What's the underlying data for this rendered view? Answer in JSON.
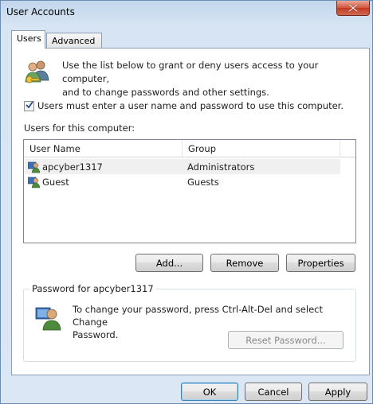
{
  "window": {
    "title": "User Accounts"
  },
  "tabs": [
    {
      "label": "Users",
      "selected": true
    },
    {
      "label": "Advanced",
      "selected": false
    }
  ],
  "users_tab": {
    "intro_line1": "Use the list below to grant or deny users access to your computer,",
    "intro_line2": "and to change passwords and other settings.",
    "require_login_label": "Users must enter a user name and password to use this computer.",
    "require_login_checked": true,
    "list_label": "Users for this computer:",
    "columns": [
      "User Name",
      "Group"
    ],
    "users": [
      {
        "name": "apcyber1317",
        "group": "Administrators",
        "selected": true
      },
      {
        "name": "Guest",
        "group": "Guests",
        "selected": false
      }
    ],
    "buttons": {
      "add": "Add...",
      "remove": "Remove",
      "properties": "Properties"
    },
    "password_group": {
      "legend": "Password for apcyber1317",
      "text_line1": "To change your password, press Ctrl-Alt-Del and select Change",
      "text_line2": "Password.",
      "reset_button": "Reset Password...",
      "reset_enabled": false
    }
  },
  "footer": {
    "ok": "OK",
    "cancel": "Cancel",
    "apply": "Apply"
  },
  "icons": {
    "close": "close-icon",
    "users": "users-key-icon",
    "user": "user-icon",
    "check": "checkmark-icon"
  },
  "colors": {
    "titlebar": "#c2d6ec",
    "close_button": "#c13a22",
    "selection_row": "#f0f0f0",
    "default_button_border": "#3c7fb1"
  }
}
